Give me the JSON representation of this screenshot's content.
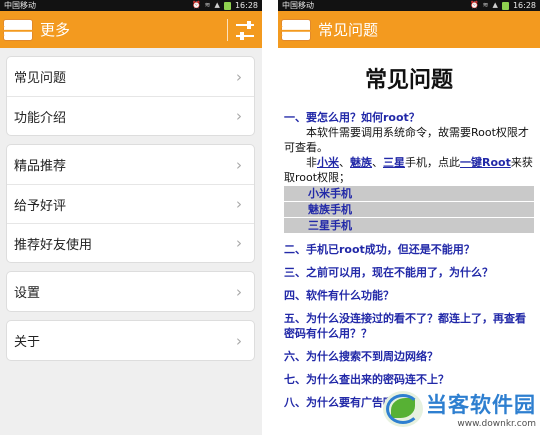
{
  "status": {
    "carrier": "中国移动",
    "time": "16:28"
  },
  "left": {
    "title": "更多",
    "groups": [
      [
        "常见问题",
        "功能介绍"
      ],
      [
        "精品推荐",
        "给予好评",
        "推荐好友使用"
      ],
      [
        "设置"
      ],
      [
        "关于"
      ]
    ]
  },
  "right": {
    "title": "常见问题",
    "doc_title": "常见问题",
    "q1": "一、要怎么用？如何root？",
    "p1": "本软件需要调用系统命令，故需要Root权限才可查看。",
    "p2_pre": "非",
    "p2_link1": "小米",
    "p2_sep1": "、",
    "p2_link2": "魅族",
    "p2_sep2": "、",
    "p2_link3": "三星",
    "p2_mid": "手机，点此",
    "p2_link4": "一键Root",
    "p2_post": "来获取root权限；",
    "bars": [
      "小米手机",
      "魅族手机",
      "三星手机"
    ],
    "questions": [
      "二、手机已root成功，但还是不能用？",
      "三、之前可以用，现在不能用了，为什么？",
      "四、软件有什么功能？",
      "五、为什么没连接过的看不了？都连上了，再查看密码有什么用？？",
      "六、为什么搜索不到周边网络？",
      "七、为什么查出来的密码连不上？",
      "八、为什么要有广告呢？"
    ]
  },
  "watermark": {
    "name": "当客软件园",
    "url": "www.downkr.com"
  }
}
